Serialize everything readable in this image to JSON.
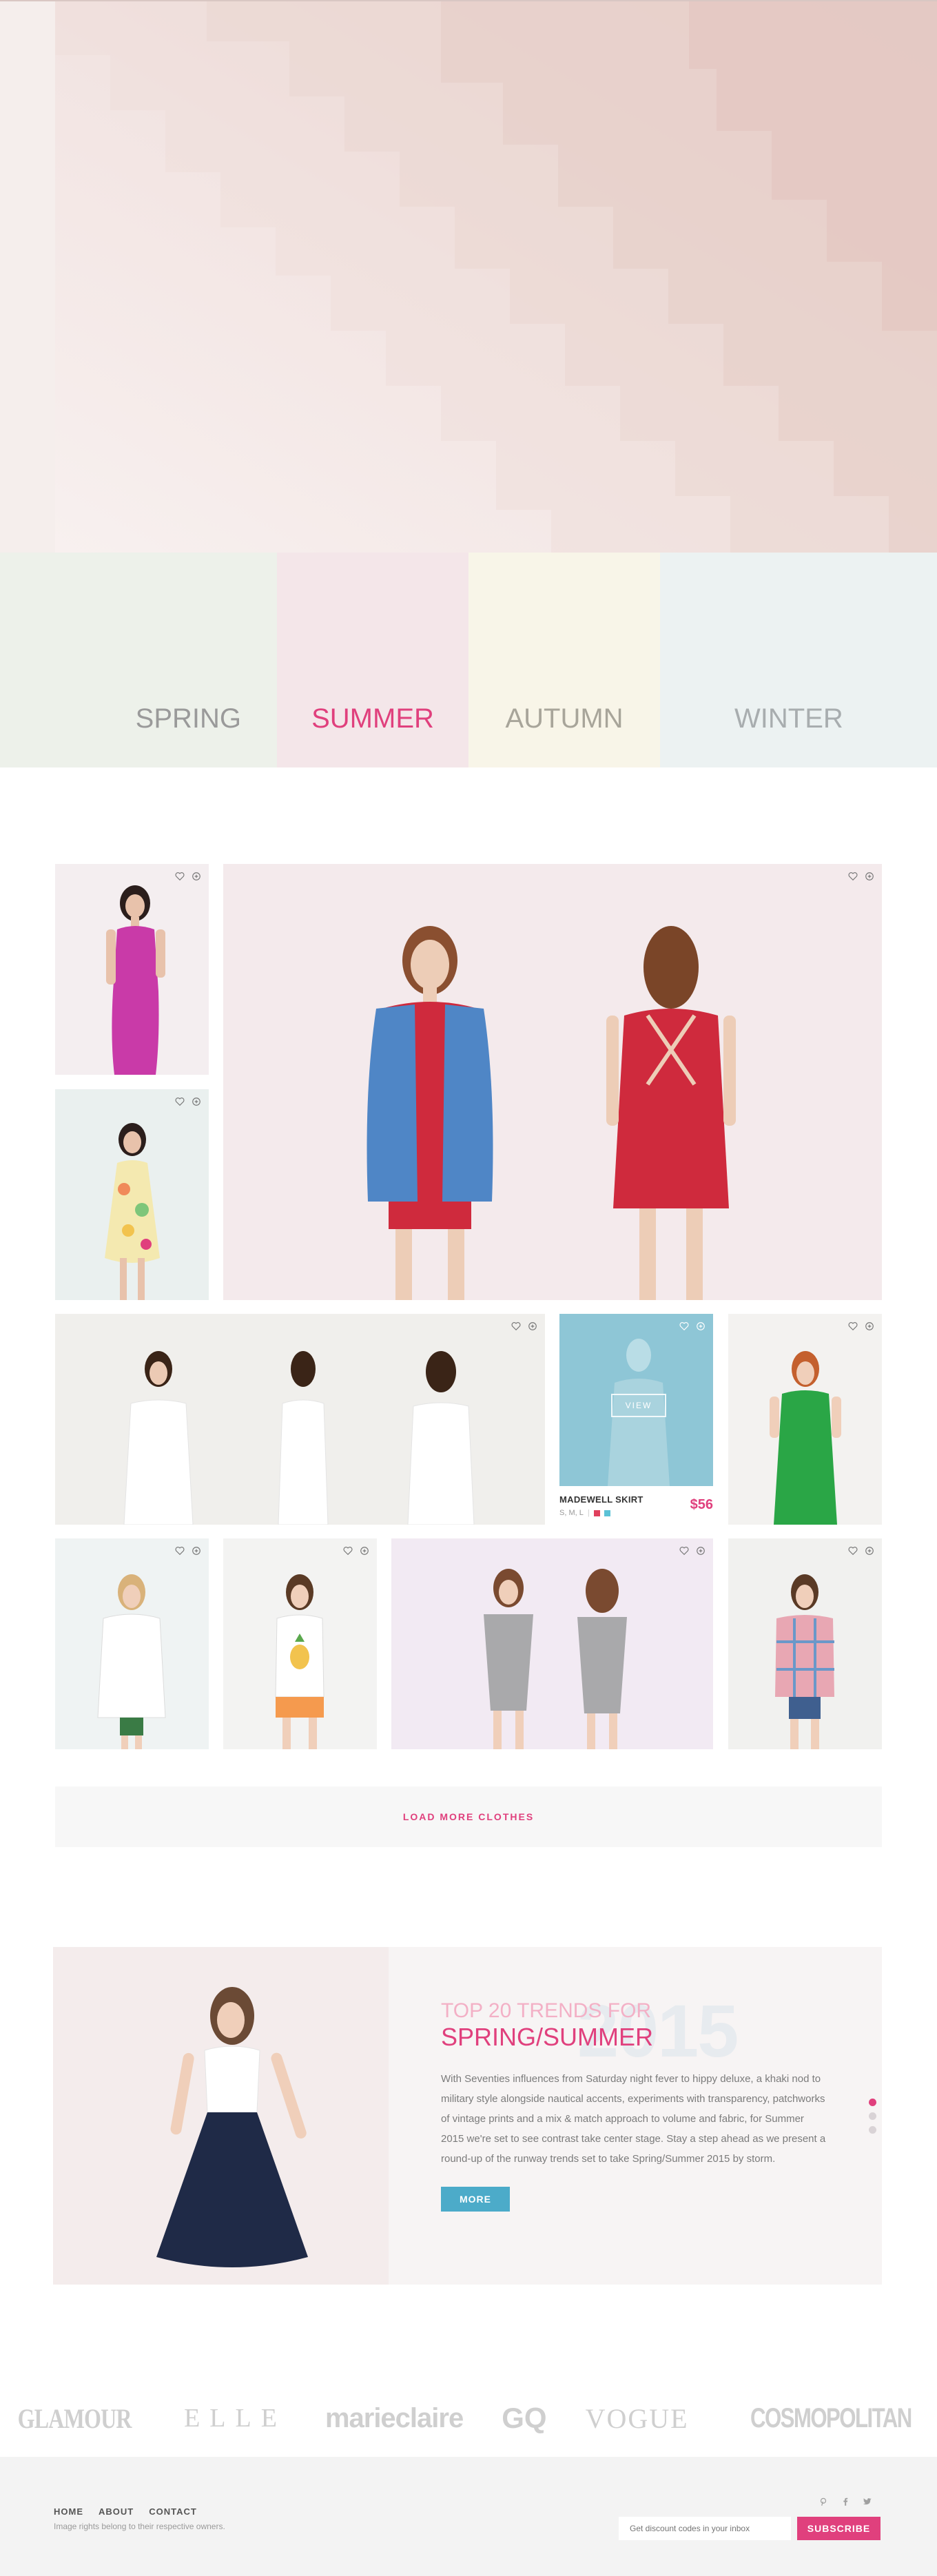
{
  "seasons": [
    "SPRING",
    "SUMMER",
    "AUTUMN",
    "WINTER"
  ],
  "active_season": "SUMMER",
  "product": {
    "view_label": "VIEW",
    "name": "MADEWELL SKIRT",
    "sizes": "S, M, L",
    "price": "$56",
    "colors": [
      "#e0405d",
      "#5bc2d6"
    ]
  },
  "load_more_label": "LOAD MORE CLOTHES",
  "trends": {
    "kicker": "TOP 20 TRENDS FOR",
    "title": "SPRING/SUMMER",
    "year": "2015",
    "body": "With Seventies influences from Saturday night fever to hippy deluxe, a khaki nod to military style alongside nautical accents, experiments with transparency, patchworks of vintage prints and a mix & match approach to volume and fabric, for Summer 2015 we're set to see contrast take center stage. Stay a step ahead as we present a round-up of the runway trends set to take Spring/Summer 2015 by storm.",
    "more_label": "MORE"
  },
  "brands": [
    "GLAMOUR",
    "ELLE",
    "marieclaire",
    "GQ",
    "VOGUE",
    "COSMOPOLITAN"
  ],
  "footer": {
    "nav": [
      "HOME",
      "ABOUT",
      "CONTACT"
    ],
    "note": "Image rights belong to their respective owners.",
    "subscribe_placeholder": "Get discount codes in your inbox",
    "subscribe_label": "SUBSCRIBE"
  },
  "colors": {
    "accent": "#e0407d",
    "button_blue": "#4cabc9"
  }
}
